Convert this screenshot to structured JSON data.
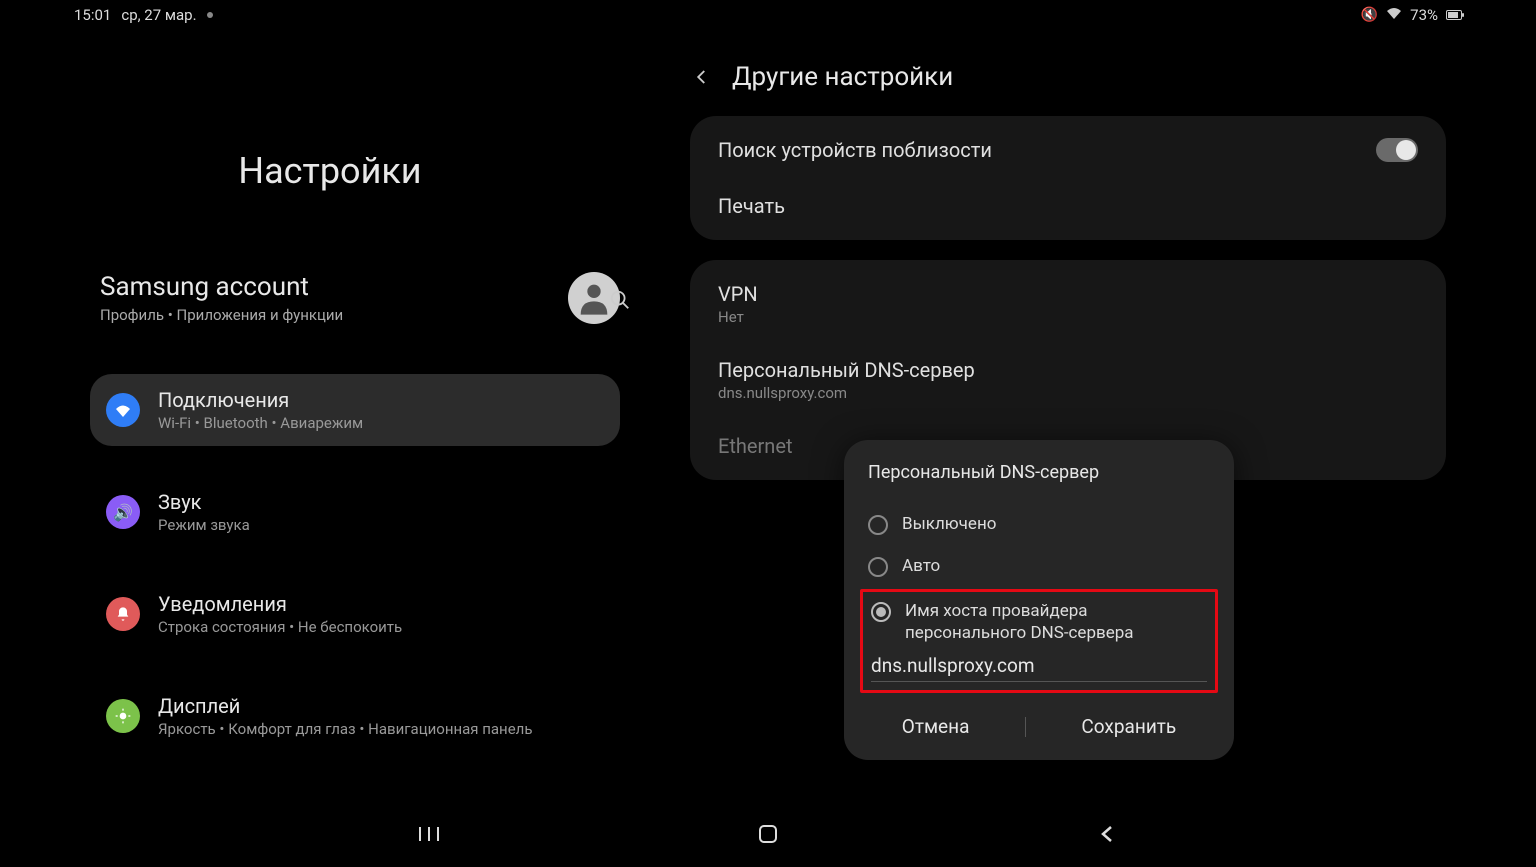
{
  "status": {
    "time": "15:01",
    "date": "ср, 27 мар.",
    "battery": "73%"
  },
  "left": {
    "title": "Настройки",
    "account": {
      "title": "Samsung account",
      "subtitle": "Профиль  •  Приложения и функции"
    },
    "categories": [
      {
        "label": "Подключения",
        "sub": "Wi-Fi  •  Bluetooth  •  Авиарежим",
        "color": "#2f7df6",
        "icon": "wifi",
        "selected": true
      },
      {
        "label": "Звук",
        "sub": "Режим звука",
        "color": "#8a5cf6",
        "icon": "sound",
        "selected": false
      },
      {
        "label": "Уведомления",
        "sub": "Строка состояния  •  Не беспокоить",
        "color": "#e05a5a",
        "icon": "notif",
        "selected": false
      },
      {
        "label": "Дисплей",
        "sub": "Яркость  •  Комфорт для глаз  •  Навигационная панель",
        "color": "#7cc24a",
        "icon": "display",
        "selected": false
      }
    ]
  },
  "right": {
    "title": "Другие настройки",
    "group1": [
      {
        "label": "Поиск устройств поблизости",
        "toggle": true
      },
      {
        "label": "Печать"
      }
    ],
    "group2": [
      {
        "label": "VPN",
        "sub": "Нет"
      },
      {
        "label": "Персональный DNS-сервер",
        "sub": "dns.nullsproxy.com"
      },
      {
        "label": "Ethernet",
        "faded": true
      }
    ]
  },
  "dialog": {
    "title": "Персональный DNS-сервер",
    "opt_off": "Выключено",
    "opt_auto": "Авто",
    "opt_host": "Имя хоста провайдера персонального DNS-сервера",
    "host_value": "dns.nullsproxy.com",
    "cancel": "Отмена",
    "save": "Сохранить"
  }
}
